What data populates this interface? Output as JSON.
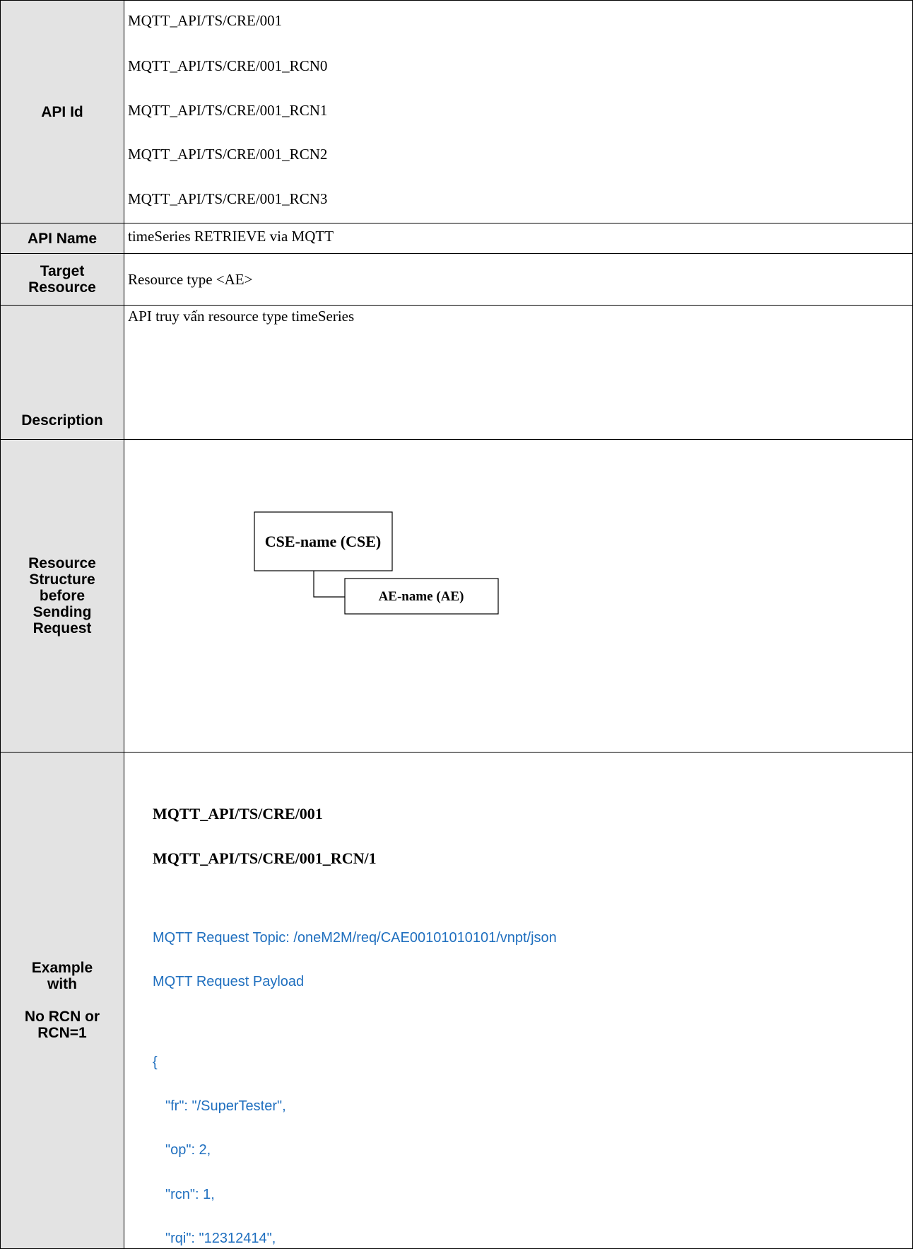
{
  "rows": {
    "api_id": {
      "label": "API Id",
      "ids": [
        "MQTT_API/TS/CRE/001",
        "MQTT_API/TS/CRE/001_RCN0",
        "MQTT_API/TS/CRE/001_RCN1",
        "MQTT_API/TS/CRE/001_RCN2",
        "MQTT_API/TS/CRE/001_RCN3"
      ]
    },
    "api_name": {
      "label": "API Name",
      "value": "timeSeries RETRIEVE via MQTT"
    },
    "target_resource": {
      "label_line1": "Target",
      "label_line2": "Resource",
      "value": "Resource type <AE>"
    },
    "description": {
      "label": "Description",
      "value": "API truy vấn resource type timeSeries"
    },
    "resource_structure": {
      "label_lines": [
        "Resource",
        "Structure",
        "before",
        "Sending",
        "Request"
      ],
      "diagram": {
        "parent": "CSE-name (CSE)",
        "child": "AE-name (AE)"
      }
    },
    "example": {
      "label_lines_top": [
        "Example",
        "with"
      ],
      "label_lines_bottom": [
        "No RCN or",
        "RCN=1"
      ],
      "headings": [
        "MQTT_API/TS/CRE/001",
        "MQTT_API/TS/CRE/001_RCN/1"
      ],
      "topic": "MQTT Request Topic: /oneM2M/req/CAE00101010101/vnpt/json",
      "payload_label": "MQTT Request Payload",
      "payload_lines": [
        "{",
        "\"fr\": \"/SuperTester\",",
        "\"op\": 2,",
        "\"rcn\": 1,",
        "\"rqi\": \"12312414\","
      ]
    }
  },
  "colors": {
    "label_bg": "#e3e3e3",
    "payload_blue": "#1f6fbf"
  }
}
